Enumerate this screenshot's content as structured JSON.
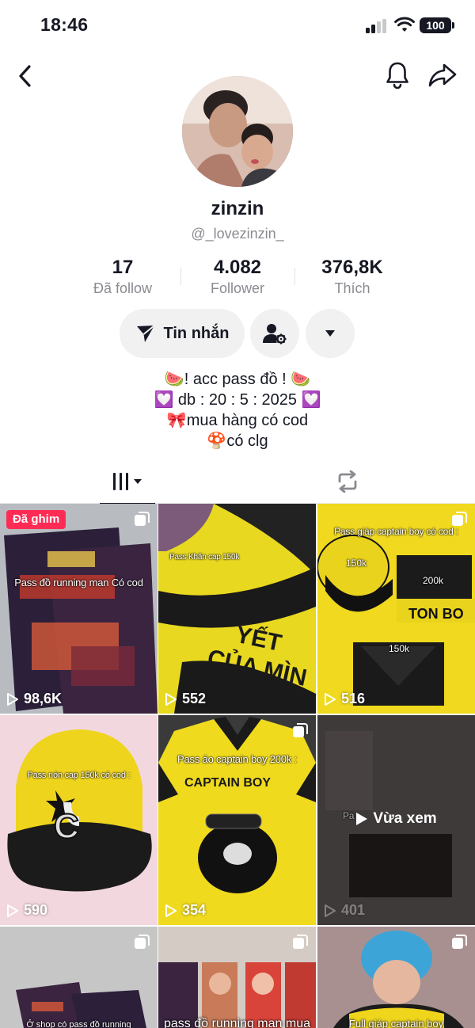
{
  "status_bar": {
    "time": "18:46",
    "battery": "100"
  },
  "profile": {
    "display_name": "zinzin",
    "username": "@_lovezinzin_",
    "stats": [
      {
        "value": "17",
        "label": "Đã follow"
      },
      {
        "value": "4.082",
        "label": "Follower"
      },
      {
        "value": "376,8K",
        "label": "Thích"
      }
    ],
    "message_button": "Tin nhắn",
    "bio": [
      "🍉! acc pass đồ ! 🍉",
      "💟 db : 20 : 5 : 2025 💟",
      "🎀mua hàng có cod",
      "🍄có clg"
    ]
  },
  "tabs": [
    {
      "name": "videos",
      "icon": "grid-icon",
      "active": true
    },
    {
      "name": "reposts",
      "icon": "repost-icon",
      "active": false
    }
  ],
  "videos": [
    {
      "views": "98,6K",
      "pinned_label": "Đã ghim",
      "caption": "Pass đồ running man Có cod",
      "multi": true
    },
    {
      "views": "552",
      "caption": "Pass Khăn cap 150k",
      "multi": false
    },
    {
      "views": "516",
      "caption": "Pass giáp captain boy có cod :",
      "tags": [
        "150k",
        "200k",
        "150k"
      ],
      "multi": true
    },
    {
      "views": "590",
      "caption": "Pass nón cap 150k có cod :",
      "multi": false
    },
    {
      "views": "354",
      "caption": "Pass áo captain boy 200k :",
      "multi": true
    },
    {
      "views": "401",
      "watched_label": "Vừa xem",
      "caption": "Pa",
      "multi": false
    },
    {
      "caption": "Ở shop có pass đồ running",
      "multi": true
    },
    {
      "caption": "pass đồ running man mua",
      "multi": true
    },
    {
      "caption": "Full giáp captain boy",
      "multi": true
    }
  ],
  "colors": {
    "accent": "#fe2c55",
    "text": "#161823",
    "muted": "#8a8b91",
    "button_bg": "#f1f1f2",
    "tile_yellow": "#f2dc23"
  }
}
